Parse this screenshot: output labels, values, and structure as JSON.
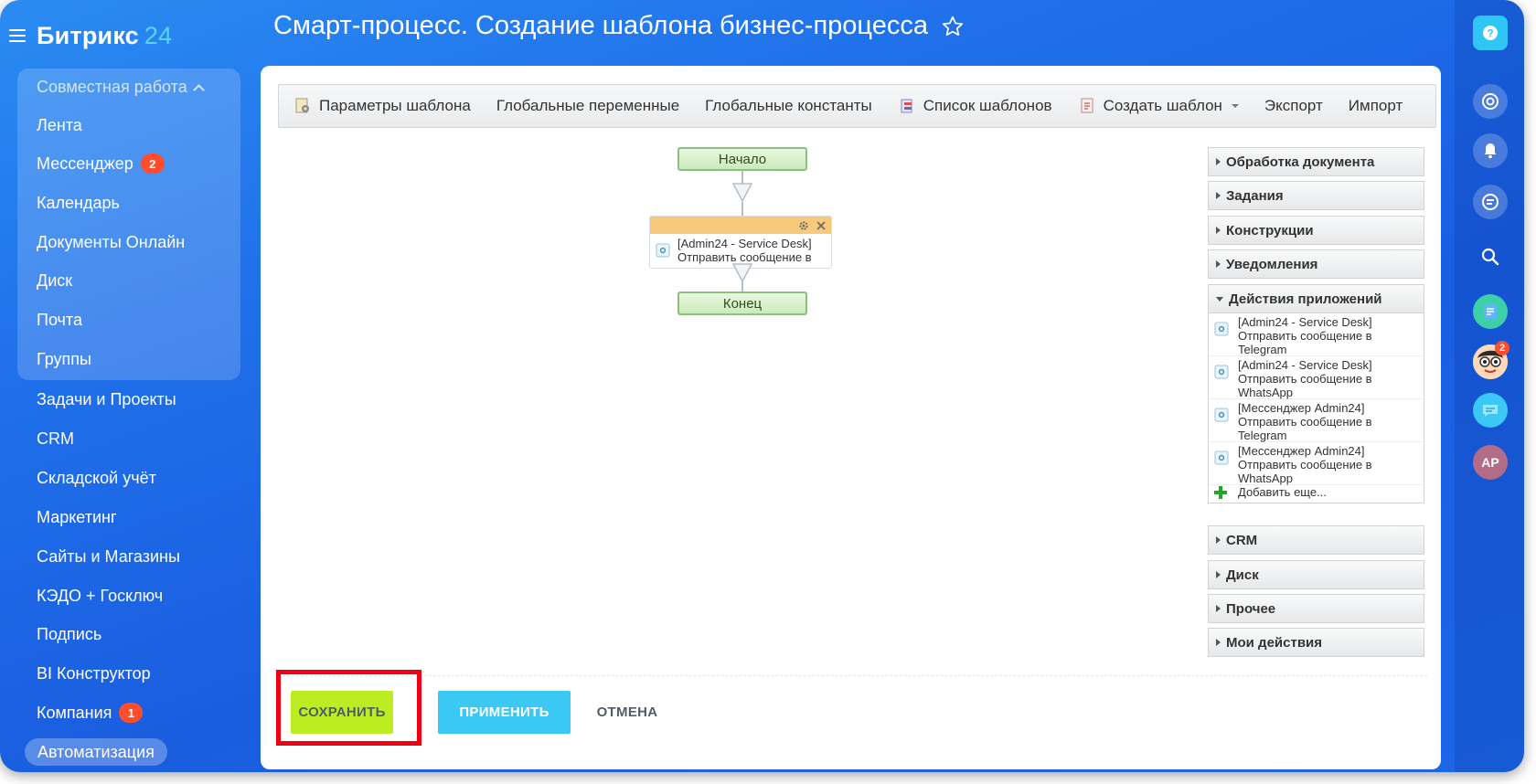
{
  "app": {
    "logo_main": "Битрикс",
    "logo_num": "24"
  },
  "page": {
    "title": "Смарт-процесс. Создание шаблона бизнес-процесса"
  },
  "sidebar": {
    "group_title": "Совместная работа",
    "items": [
      {
        "label": "Лента",
        "badge": null
      },
      {
        "label": "Мессенджер",
        "badge": "2"
      },
      {
        "label": "Календарь",
        "badge": null
      },
      {
        "label": "Документы Онлайн",
        "badge": null
      },
      {
        "label": "Диск",
        "badge": null
      },
      {
        "label": "Почта",
        "badge": null
      },
      {
        "label": "Группы",
        "badge": null
      },
      {
        "label": "Задачи и Проекты",
        "badge": null
      },
      {
        "label": "CRM",
        "badge": null
      },
      {
        "label": "Складской учёт",
        "badge": null
      },
      {
        "label": "Маркетинг",
        "badge": null
      },
      {
        "label": "Сайты и Магазины",
        "badge": null
      },
      {
        "label": "КЭДО + Госключ",
        "badge": null
      },
      {
        "label": "Подпись",
        "badge": null
      },
      {
        "label": "BI Конструктор",
        "badge": null
      },
      {
        "label": "Компания",
        "badge": "1"
      }
    ],
    "active_item": "Автоматизация"
  },
  "toolbar": {
    "template_params": "Параметры шаблона",
    "global_vars": "Глобальные переменные",
    "global_consts": "Глобальные константы",
    "templates_list": "Список шаблонов",
    "create_template": "Создать шаблон",
    "export": "Экспорт",
    "import": "Импорт"
  },
  "workflow": {
    "start": "Начало",
    "end": "Конец",
    "activity_line1": "[Admin24 - Service Desk]",
    "activity_line2": "Отправить сообщение в"
  },
  "tree": {
    "sections_top": [
      "Обработка документа",
      "Задания",
      "Конструкции",
      "Уведомления"
    ],
    "open_section": "Действия приложений",
    "entries": [
      {
        "l1": "[Admin24 - Service Desk]",
        "l2": "Отправить сообщение в",
        "l3": "Telegram"
      },
      {
        "l1": "[Admin24 - Service Desk]",
        "l2": "Отправить сообщение в",
        "l3": "WhatsApp"
      },
      {
        "l1": "[Мессенджер Admin24]",
        "l2": "Отправить сообщение в",
        "l3": "Telegram"
      },
      {
        "l1": "[Мессенджер Admin24]",
        "l2": "Отправить сообщение в",
        "l3": "WhatsApp"
      }
    ],
    "add_more": "Добавить еще...",
    "sections_bottom": [
      "CRM",
      "Диск",
      "Прочее",
      "Мои действия"
    ]
  },
  "buttons": {
    "save": "СОХРАНИТЬ",
    "apply": "ПРИМЕНИТЬ",
    "cancel": "ОТМЕНА"
  },
  "rightbar": {
    "avatar_initials": "AP",
    "avatar_badge": "2"
  },
  "colors": {
    "accent": "#2fc6f6",
    "save": "#bbed21",
    "highlight": "#f00012",
    "badge": "#ff4d2e"
  }
}
